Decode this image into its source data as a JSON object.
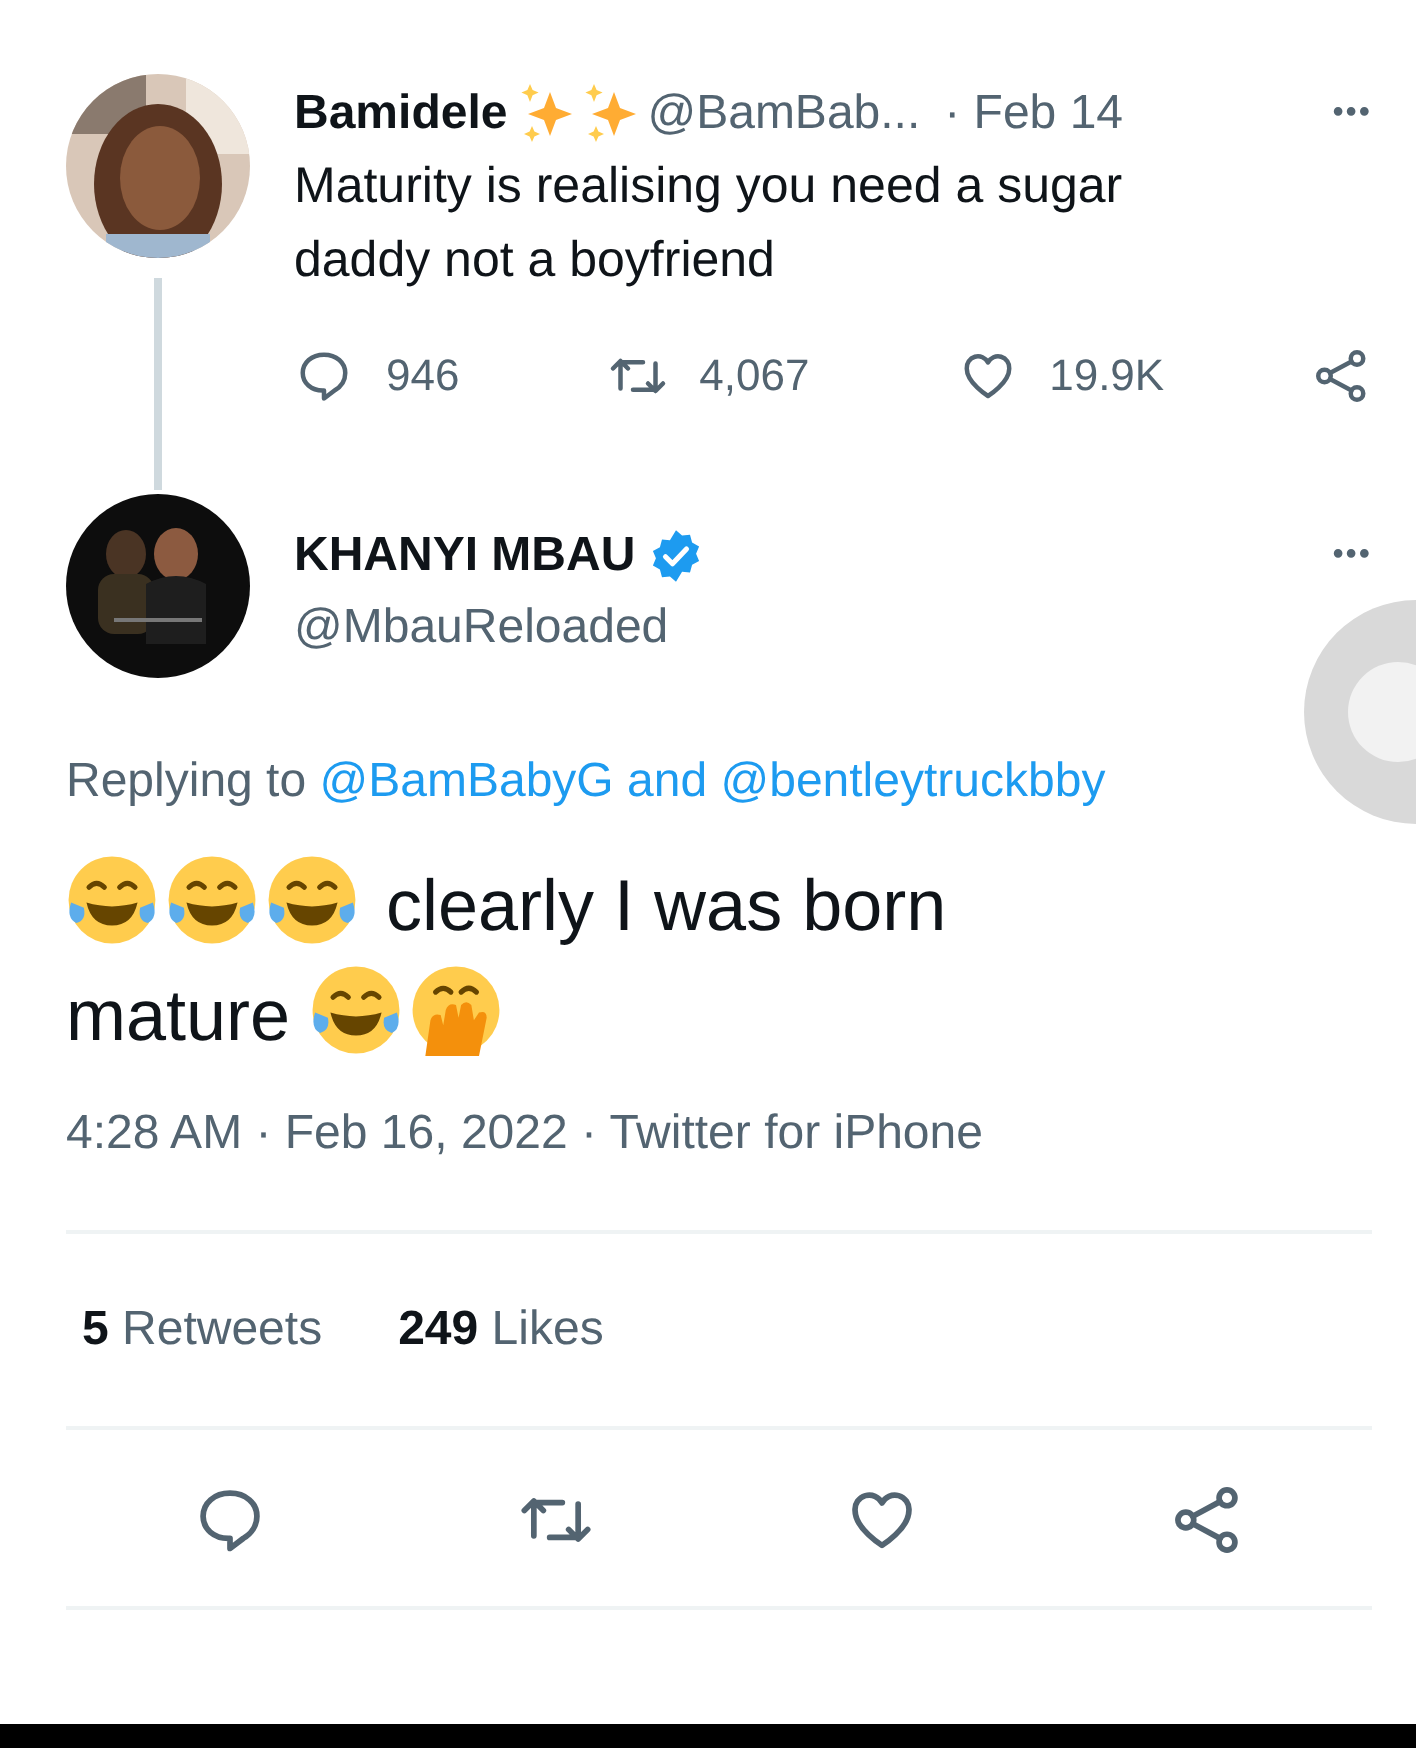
{
  "parent_tweet": {
    "name": "Bamidele",
    "name_icons": [
      {
        "kind": "sparkles"
      },
      {
        "kind": "sparkles"
      }
    ],
    "handle": "@BamBab...",
    "date": "· Feb 14",
    "more": "•••",
    "text": "Maturity is realising you need a sugar daddy not a boyfriend",
    "actions": [
      {
        "kind": "reply",
        "count": "946"
      },
      {
        "kind": "retweet",
        "count": "4,067"
      },
      {
        "kind": "like",
        "count": "19.9K"
      },
      {
        "kind": "share"
      }
    ]
  },
  "tweet": {
    "name": "KHANYI MBAU",
    "verified": true,
    "handle": "@MbauReloaded",
    "more": "•••",
    "replying_label": "Replying to",
    "replying_to": [
      "@BamBabyG",
      "@bentleytruckbby"
    ],
    "joiner": "and",
    "body": [
      {
        "kind": "joy"
      },
      {
        "kind": "joy"
      },
      {
        "kind": "joy"
      },
      {
        "kind": "text",
        "text": "clearly I was born"
      },
      {
        "kind": "break"
      },
      {
        "kind": "text",
        "text": "mature"
      },
      {
        "kind": "joy"
      },
      {
        "kind": "hand_over_mouth"
      }
    ],
    "meta": "4:28 AM · Feb 16, 2022 · Twitter for iPhone",
    "stats": [
      {
        "count": "5",
        "label": "Retweets"
      },
      {
        "count": "249",
        "label": "Likes"
      }
    ],
    "actions": [
      {
        "kind": "reply"
      },
      {
        "kind": "retweet"
      },
      {
        "kind": "like"
      },
      {
        "kind": "share"
      }
    ]
  }
}
